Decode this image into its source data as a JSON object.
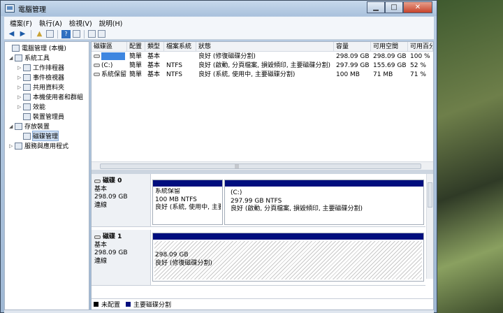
{
  "window": {
    "title": "電腦管理"
  },
  "menu": [
    "檔案(F)",
    "執行(A)",
    "檢視(V)",
    "說明(H)"
  ],
  "tree": [
    {
      "label": "電腦管理 (本機)",
      "level": 0,
      "twisty": ""
    },
    {
      "label": "系統工具",
      "level": 1,
      "twisty": "◢"
    },
    {
      "label": "工作排程器",
      "level": 2,
      "twisty": "▷"
    },
    {
      "label": "事件檢視器",
      "level": 2,
      "twisty": "▷"
    },
    {
      "label": "共用資料夾",
      "level": 2,
      "twisty": "▷"
    },
    {
      "label": "本機使用者和群組",
      "level": 2,
      "twisty": "▷"
    },
    {
      "label": "效能",
      "level": 2,
      "twisty": "▷"
    },
    {
      "label": "裝置管理員",
      "level": 2,
      "twisty": ""
    },
    {
      "label": "存放裝置",
      "level": 1,
      "twisty": "◢"
    },
    {
      "label": "磁碟管理",
      "level": 2,
      "twisty": "",
      "selected": true
    },
    {
      "label": "服務與應用程式",
      "level": 1,
      "twisty": "▷"
    }
  ],
  "volume_list": {
    "columns": [
      "磁碟區",
      "配置",
      "類型",
      "檔案系統",
      "狀態",
      "容量",
      "可用空間",
      "可用百分"
    ],
    "rows": [
      [
        "",
        "簡單",
        "基本",
        "",
        "良好 (修復磁碟分割)",
        "298.09 GB",
        "298.09 GB",
        "100 %"
      ],
      [
        "(C:)",
        "簡單",
        "基本",
        "NTFS",
        "良好 (啟動, 分頁檔案, 損毀傾印, 主要磁碟分割)",
        "297.99 GB",
        "155.69 GB",
        "52 %"
      ],
      [
        "系統保留",
        "簡單",
        "基本",
        "NTFS",
        "良好 (系統, 使用中, 主要磁碟分割)",
        "100 MB",
        "71 MB",
        "71 %"
      ]
    ]
  },
  "disks": [
    {
      "name": "磁碟 0",
      "type": "基本",
      "size": "298.09 GB",
      "status": "連線",
      "partitions": [
        {
          "title": "系統保留",
          "detail": "100 MB NTFS",
          "status": "良好 (系統, 使用中, 主要磁碟分割)"
        },
        {
          "title": "(C:)",
          "detail": "297.99 GB NTFS",
          "status": "良好 (啟動, 分頁檔案, 損毀傾印, 主要磁碟分割)"
        }
      ]
    },
    {
      "name": "磁碟 1",
      "type": "基本",
      "size": "298.09 GB",
      "status": "連線",
      "partitions": [
        {
          "title": "",
          "detail": "298.09 GB",
          "status": "良好 (修復磁碟分割)"
        }
      ]
    }
  ],
  "legend": [
    {
      "label": "未配置",
      "color": "#000000"
    },
    {
      "label": "主要磁碟分割",
      "color": "#000e7e"
    }
  ]
}
